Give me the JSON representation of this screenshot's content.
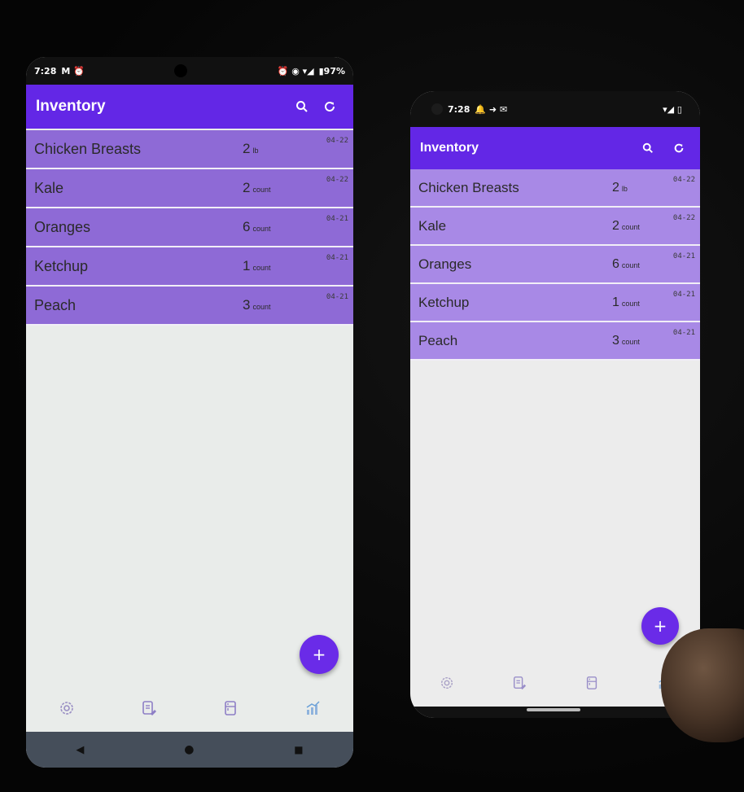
{
  "left_phone": {
    "status": {
      "time": "7:28",
      "icons_left": "M ⏰",
      "icons_right": "⏰ ◉ ▾◢",
      "battery": "▮97%"
    },
    "appbar": {
      "title": "Inventory",
      "search_icon": "search-icon",
      "refresh_icon": "refresh-icon"
    },
    "items": [
      {
        "name": "Chicken Breasts",
        "qty": "2",
        "unit": "lb",
        "date": "04-22"
      },
      {
        "name": "Kale",
        "qty": "2",
        "unit": "count",
        "date": "04-22"
      },
      {
        "name": "Oranges",
        "qty": "6",
        "unit": "count",
        "date": "04-21"
      },
      {
        "name": "Ketchup",
        "qty": "1",
        "unit": "count",
        "date": "04-21"
      },
      {
        "name": "Peach",
        "qty": "3",
        "unit": "count",
        "date": "04-21"
      }
    ],
    "fab": "+",
    "nav": [
      "settings-icon",
      "edit-list-icon",
      "fridge-icon",
      "chart-icon"
    ],
    "sysnav": {
      "back": "◀",
      "home": "●",
      "recents": "■"
    }
  },
  "right_phone": {
    "status": {
      "time": "7:28",
      "icons_left": "🔔 ➜ ✉",
      "icons_right": "▾◢ ▯"
    },
    "appbar": {
      "title": "Inventory",
      "search_icon": "search-icon",
      "refresh_icon": "refresh-icon"
    },
    "items": [
      {
        "name": "Chicken Breasts",
        "qty": "2",
        "unit": "lb",
        "date": "04-22"
      },
      {
        "name": "Kale",
        "qty": "2",
        "unit": "count",
        "date": "04-22"
      },
      {
        "name": "Oranges",
        "qty": "6",
        "unit": "count",
        "date": "04-21"
      },
      {
        "name": "Ketchup",
        "qty": "1",
        "unit": "count",
        "date": "04-21"
      },
      {
        "name": "Peach",
        "qty": "3",
        "unit": "count",
        "date": "04-21"
      }
    ],
    "fab": "+",
    "nav": [
      "settings-icon",
      "edit-list-icon",
      "fridge-icon",
      "chart-icon"
    ]
  },
  "colors": {
    "primary": "#6327e6",
    "row_left": "#8e6ad6",
    "row_right": "#a889e6",
    "background": "#e9ecea"
  }
}
